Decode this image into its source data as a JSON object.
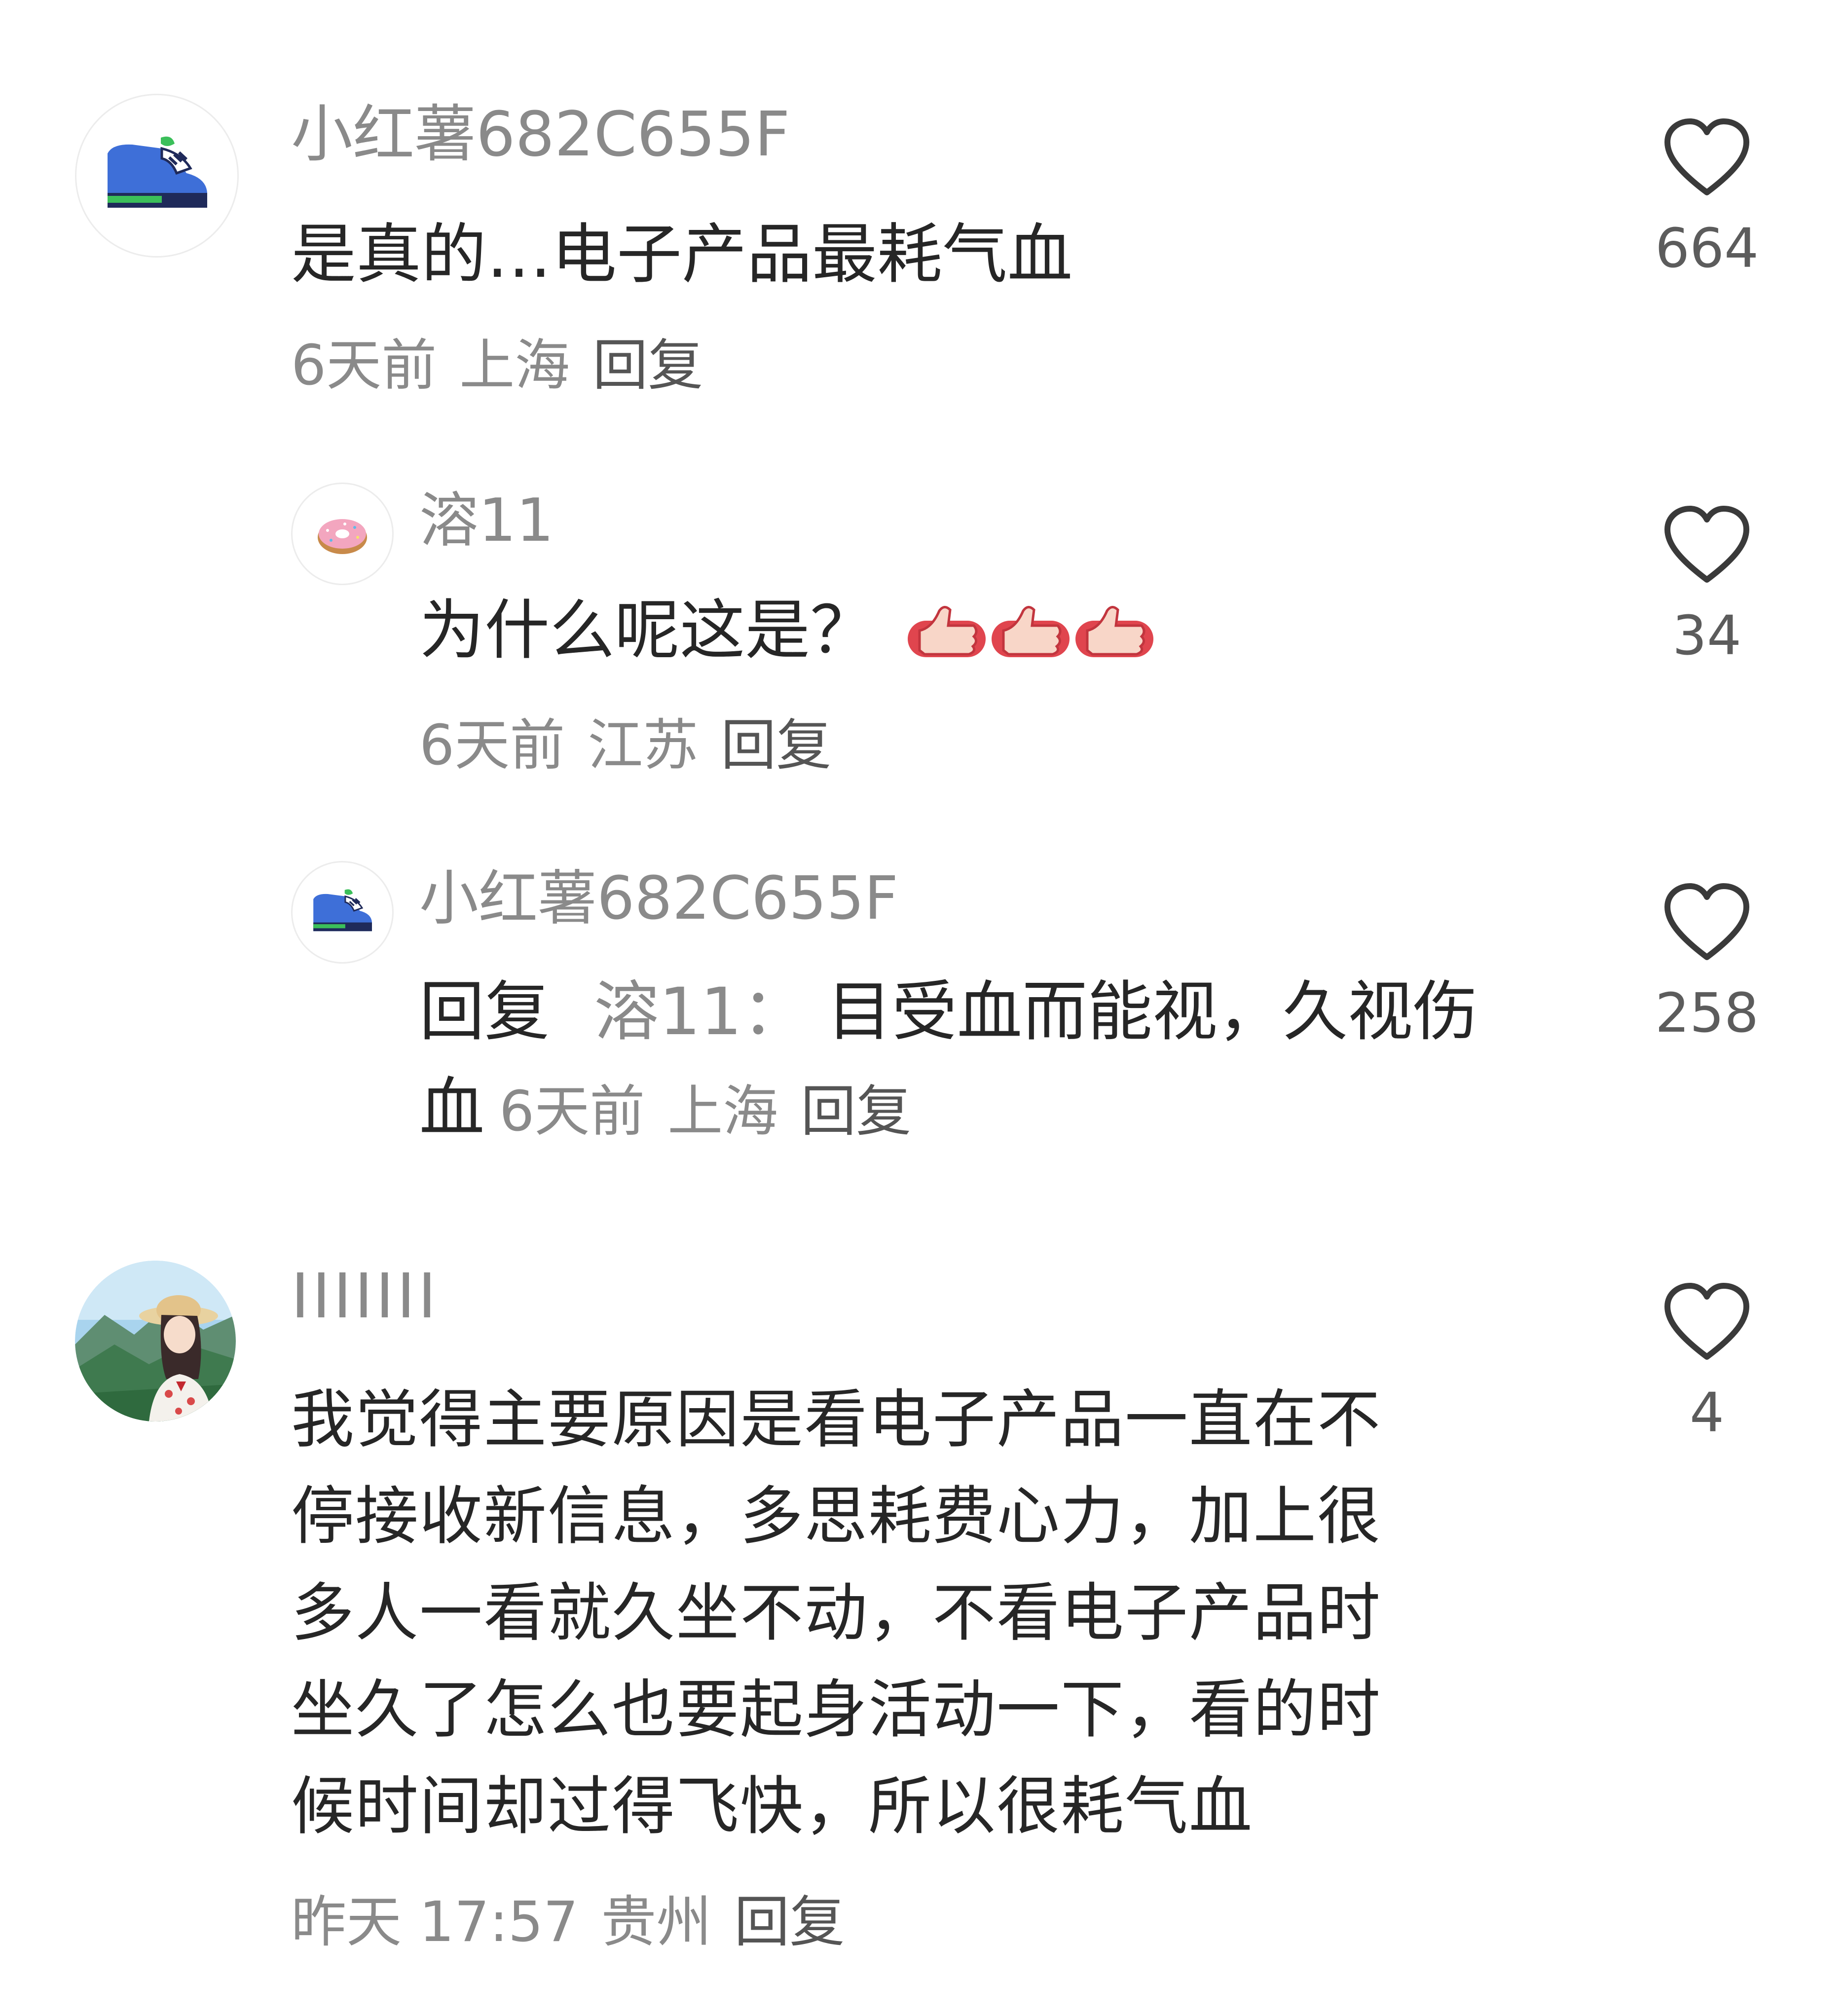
{
  "comments": [
    {
      "user": "小红薯682C655F",
      "avatar_icon": "sneaker-icon",
      "text": "是真的…电子产品最耗气血",
      "time": "6天前",
      "location": "上海",
      "reply_label": "回复",
      "likes": "664"
    },
    {
      "user": "溶11",
      "avatar_icon": "donut-icon",
      "text": "为什么呢这是？",
      "emoji": [
        "thumbs-up-icon",
        "thumbs-up-icon",
        "thumbs-up-icon"
      ],
      "time": "6天前",
      "location": "江苏",
      "reply_label": "回复",
      "likes": "34"
    },
    {
      "user": "小红薯682C655F",
      "avatar_icon": "sneaker-icon",
      "reply_prefix": "回复",
      "reply_to": "溶11：",
      "text_line1": "目受血而能视，久视伤",
      "text_line2": "血",
      "time": "6天前",
      "location": "上海",
      "reply_label": "回复",
      "likes": "258"
    },
    {
      "user": "IIIIIII",
      "avatar_icon": "girl-landscape-avatar-icon",
      "lines": [
        "我觉得主要原因是看电子产品一直在不",
        "停接收新信息，多思耗费心力，加上很",
        "多人一看就久坐不动，不看电子产品时",
        "坐久了怎么也要起身活动一下，看的时",
        "候时间却过得飞快，所以很耗气血"
      ],
      "time": "昨天 17:57",
      "location": "贵州",
      "reply_label": "回复",
      "likes": "4"
    }
  ],
  "icons": {
    "like": "heart-outline-icon"
  },
  "colors": {
    "meta": "#8a8a8a",
    "text": "#262626",
    "accent_red": "#e0454e"
  }
}
